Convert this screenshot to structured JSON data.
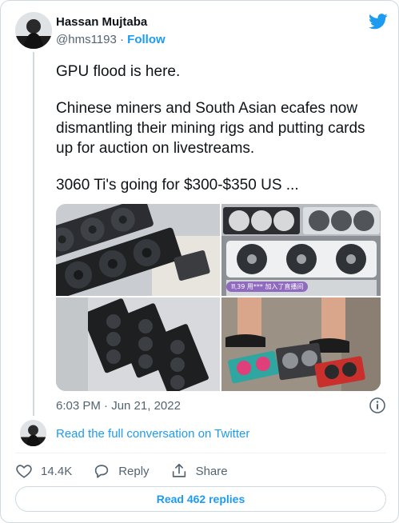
{
  "author": {
    "name": "Hassan Mujtaba",
    "handle": "@hms1193",
    "separator": "·",
    "follow_label": "Follow"
  },
  "tweet": {
    "paragraphs": [
      "GPU flood is here.",
      "Chinese miners and South Asian ecafes now dismantling their mining rigs and putting cards up for auction on livestreams.",
      "3060 Ti's going for $300-$350 US ..."
    ],
    "timestamp": "6:03 PM · Jun 21, 2022"
  },
  "media": {
    "overlay_badge": "♏39 用*** 加入了直播间"
  },
  "conversation": {
    "link_label": "Read the full conversation on Twitter"
  },
  "actions": {
    "like_count": "14.4K",
    "reply_label": "Reply",
    "share_label": "Share"
  },
  "footer": {
    "replies_button": "Read 462 replies"
  },
  "colors": {
    "accent": "#1d9bf0",
    "muted_text": "#536471",
    "border": "#cfd9de"
  },
  "icons": [
    "twitter-bird-icon",
    "info-icon",
    "heart-icon",
    "reply-bubble-icon",
    "share-icon"
  ]
}
